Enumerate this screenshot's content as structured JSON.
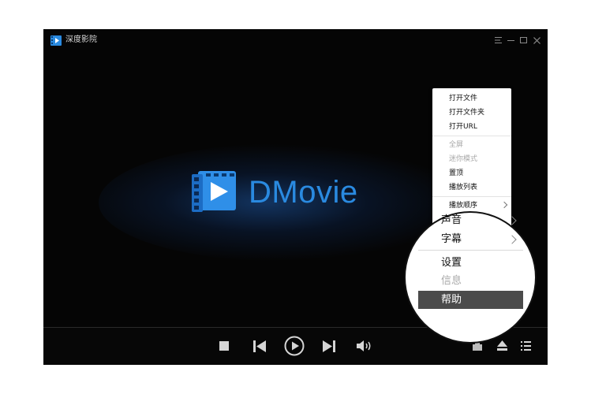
{
  "window": {
    "title": "深度影院",
    "logo_text": "DMovie"
  },
  "context_menu": {
    "items": [
      {
        "label": "打开文件",
        "disabled": false
      },
      {
        "label": "打开文件夹",
        "disabled": false
      },
      {
        "label": "打开URL",
        "disabled": false
      },
      {
        "label": "全屏",
        "disabled": true
      },
      {
        "label": "迷你模式",
        "disabled": true
      },
      {
        "label": "置顶",
        "disabled": false
      },
      {
        "label": "播放列表",
        "disabled": false
      },
      {
        "label": "播放顺序",
        "disabled": false,
        "submenu": true
      }
    ]
  },
  "zoom_menu": {
    "items": [
      {
        "label": "声音",
        "submenu": true
      },
      {
        "label": "字幕",
        "submenu": true
      },
      {
        "label": "设置",
        "disabled": false
      },
      {
        "label": "信息",
        "disabled": true
      },
      {
        "label": "帮助",
        "highlighted": true
      }
    ]
  },
  "icons": {
    "window_controls": [
      "menu-icon",
      "minimize-icon",
      "maximize-icon",
      "close-icon"
    ],
    "player_controls": [
      "stop-icon",
      "previous-icon",
      "play-icon",
      "next-icon",
      "volume-icon",
      "screenshot-icon",
      "eject-icon",
      "playlist-icon"
    ]
  },
  "colors": {
    "accent": "#2a8ae0",
    "background": "#050505",
    "highlight": "#4b4b4b"
  }
}
